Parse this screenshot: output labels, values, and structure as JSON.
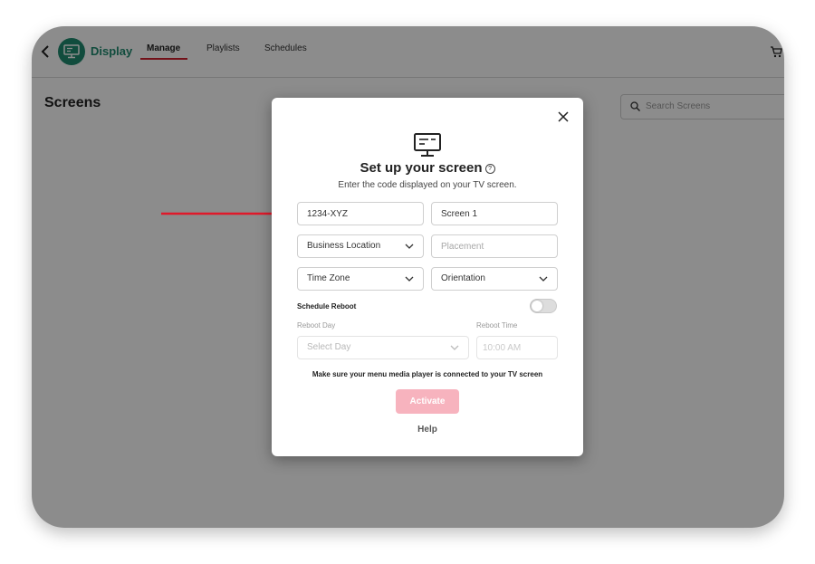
{
  "header": {
    "app_name": "Display",
    "tabs": [
      {
        "label": "Manage",
        "active": true
      },
      {
        "label": "Playlists",
        "active": false
      },
      {
        "label": "Schedules",
        "active": false
      }
    ]
  },
  "page": {
    "title": "Screens",
    "search_placeholder": "Search Screens"
  },
  "modal": {
    "title": "Set up your screen",
    "subtitle": "Enter the code displayed on your TV screen.",
    "code_value": "1234-XYZ",
    "screen_name_value": "Screen 1",
    "business_location_label": "Business Location",
    "placement_placeholder": "Placement",
    "time_zone_label": "Time Zone",
    "orientation_label": "Orientation",
    "schedule_reboot_label": "Schedule Reboot",
    "schedule_reboot_enabled": false,
    "reboot_day_label": "Reboot Day",
    "reboot_day_placeholder": "Select Day",
    "reboot_time_label": "Reboot Time",
    "reboot_time_placeholder": "10:00 AM",
    "notice": "Make sure your menu media player is connected to your TV screen",
    "activate_label": "Activate",
    "help_label": "Help"
  },
  "colors": {
    "brand_green": "#1f8a70",
    "accent_red": "#d0202e",
    "activate_disabled": "#f7b3be",
    "arrow_red": "#e0192a"
  },
  "icons": [
    "back-icon",
    "display-logo-icon",
    "cart-icon",
    "search-icon",
    "close-icon",
    "tv-screen-icon",
    "help-circle-icon",
    "chevron-down-icon"
  ]
}
